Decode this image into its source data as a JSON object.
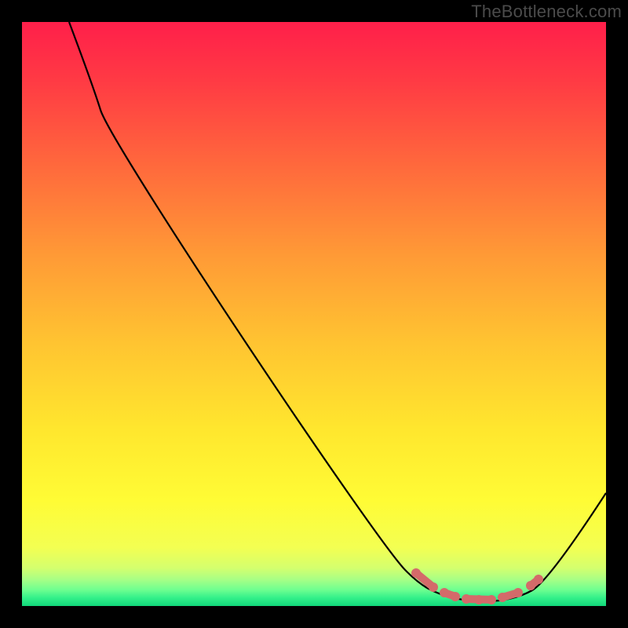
{
  "watermark": "TheBottleneck.com",
  "chart_data": {
    "type": "line",
    "title": "",
    "xlabel": "",
    "ylabel": "",
    "xlim": [
      0,
      100
    ],
    "ylim": [
      0,
      100
    ],
    "background_gradient": {
      "top": "#ff1f4a",
      "bottom": "#11d77a",
      "meaning": "red=high bottleneck, green=low bottleneck"
    },
    "series": [
      {
        "name": "bottleneck-curve",
        "color": "#000000",
        "x": [
          8,
          13,
          20,
          30,
          40,
          50,
          60,
          66,
          72,
          78,
          82,
          86,
          90,
          100
        ],
        "y": [
          100,
          88,
          79,
          65,
          51,
          37,
          23,
          12,
          5,
          1,
          0,
          2,
          6,
          20
        ]
      },
      {
        "name": "optimal-range-highlight",
        "color": "#d46a6a",
        "x": [
          67,
          70,
          72,
          74,
          76,
          78,
          80,
          82,
          85,
          87,
          88
        ],
        "y": [
          6,
          3,
          2,
          1,
          1,
          0,
          0,
          1,
          2,
          3,
          5
        ]
      }
    ],
    "annotations": []
  }
}
